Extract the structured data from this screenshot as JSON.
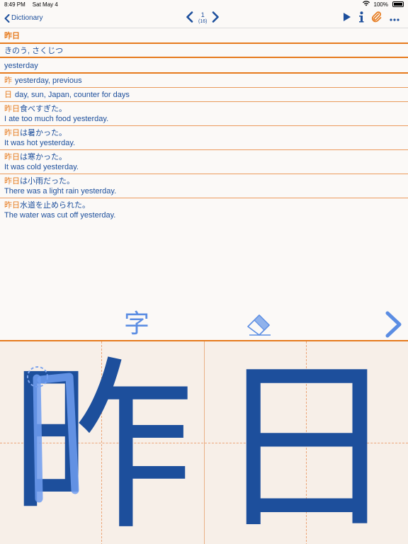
{
  "status": {
    "time": "8:49 PM",
    "date": "Sat May 4",
    "battery": "100%"
  },
  "nav": {
    "back_label": "Dictionary",
    "page_current": "1",
    "page_total": "(16)"
  },
  "entry": {
    "headword": "昨日",
    "reading": "きのう, さくじつ",
    "meaning": "yesterday",
    "kanji": [
      {
        "char": "昨",
        "meaning": "yesterday, previous"
      },
      {
        "char": "日",
        "meaning": "day, sun, Japan, counter for days"
      }
    ],
    "examples": [
      {
        "hl": "昨日",
        "jp": "食べすぎた。",
        "en": "I ate too much food yesterday."
      },
      {
        "hl": "昨日",
        "jp": "は暑かった。",
        "en": "It was hot yesterday."
      },
      {
        "hl": "昨日",
        "jp": "は寒かった。",
        "en": "It was cold yesterday."
      },
      {
        "hl": "昨日",
        "jp": "は小雨だった。",
        "en": "There was a light rain yesterday."
      },
      {
        "hl": "昨日",
        "jp": "水道を止められた。",
        "en": "The water was cut off yesterday."
      }
    ]
  },
  "practice": {
    "mode_char": "字",
    "char_left": "昨",
    "char_right": "日"
  },
  "icons": {
    "back": "chevron-left-icon",
    "prev": "chevron-left-icon",
    "next": "chevron-right-icon",
    "play": "play-icon",
    "info": "info-icon",
    "clip": "paperclip-icon",
    "more": "more-icon",
    "eraser": "eraser-icon",
    "forward": "chevron-right-icon"
  },
  "colors": {
    "accent": "#e67a1d",
    "text": "#1d4f9c",
    "stroke": "#5b8de3"
  }
}
